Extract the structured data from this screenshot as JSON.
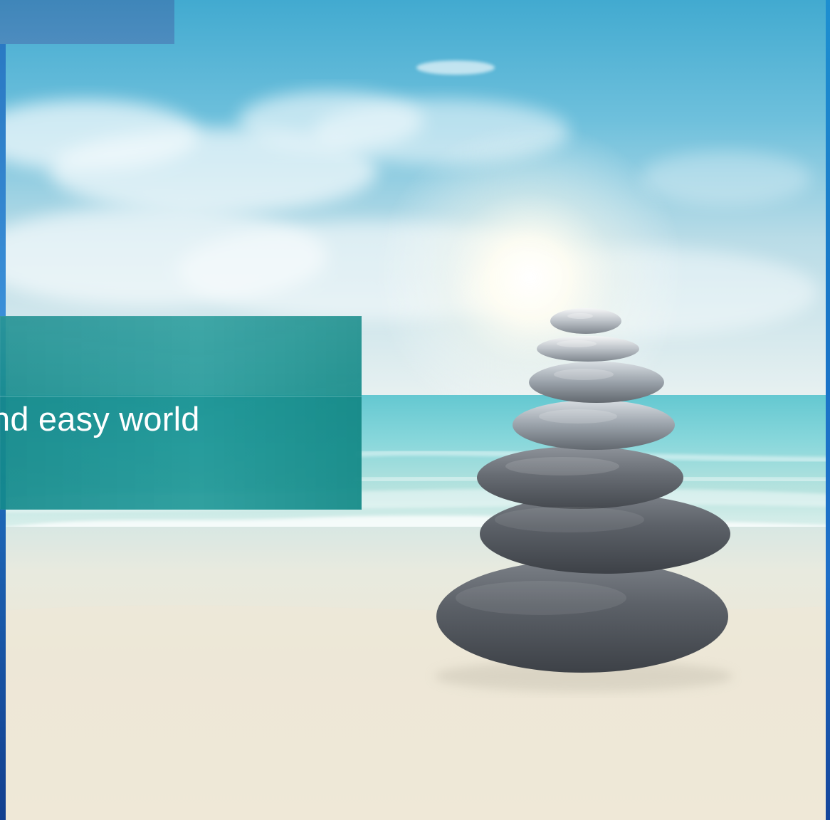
{
  "banner": {
    "headline": "nd easy world"
  },
  "colors": {
    "banner": "#148a8c",
    "sky": "#61b8d8",
    "sea": "#6ecfd6",
    "sand": "#ede6d4",
    "stones": "#676a70",
    "frame": "#2a79c3"
  },
  "icons": {
    "stone_stack": "stacked-zen-stones"
  }
}
